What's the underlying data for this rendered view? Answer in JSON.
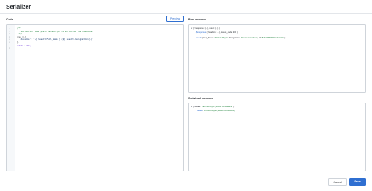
{
  "page": {
    "title": "Serializer"
  },
  "code_section": {
    "label": "Code",
    "preview_label": "Preview",
    "line_numbers": [
      "1",
      "2",
      "3",
      "4",
      "5",
      "6",
      "7",
      "8"
    ],
    "lines": [
      "/**",
      " * Serializer uses plain Javascript to serialize the response.",
      " **/",
      "res = {",
      "  'details': `${ result.Full_Name } (${ result.Designation })`",
      "}",
      "return res;",
      ""
    ]
  },
  "raw_response": {
    "label": "Raw response",
    "root_summary": "{ $response: {...}, result: {...} }",
    "response_key": "$response",
    "response_value": "{ headers: {...}, status_code: 200 }",
    "result_key": "result",
    "result_value_prefix": "{ Full_Name: ",
    "result_full_name": "'Patricia Boyle'",
    "result_designation_key": ", Designation: ",
    "result_designation": "'Senior Consultant'",
    "result_id_key": ", id: ",
    "result_id": "'5494488000001421248'",
    "result_suffix": " }"
  },
  "serialized_response": {
    "label": "Serialized response",
    "root_prefix": "{ details: ",
    "root_value": "'Patricia Boyle (Senior Consultant)'",
    "root_suffix": " }",
    "details_key": "details",
    "details_value": "Patricia Boyle (Senior Consultant)"
  },
  "footer": {
    "cancel_label": "Cancel",
    "save_label": "Save"
  },
  "colors": {
    "accent": "#2f6fd1",
    "string": "#1a7f37",
    "keyword": "#8250df"
  },
  "icons": [
    "chevron-down-icon",
    "chevron-right-icon"
  ]
}
